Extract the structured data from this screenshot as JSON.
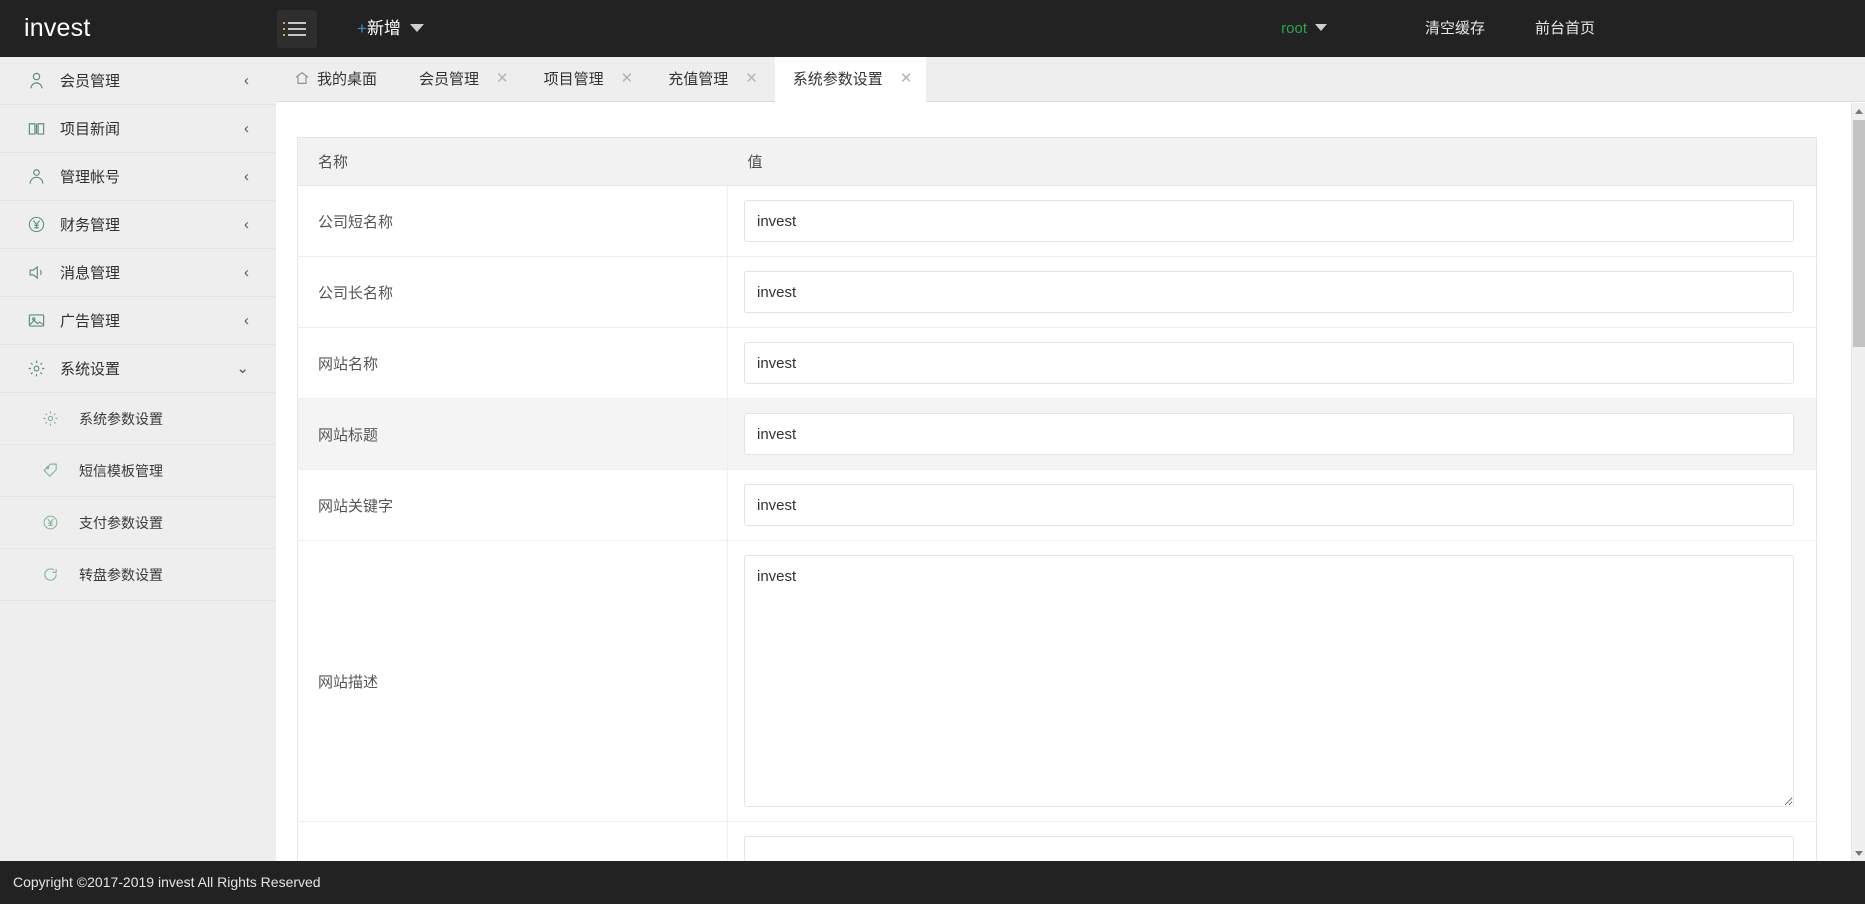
{
  "header": {
    "logo": "invest",
    "menu_toggle_icon": "hamburger-icon",
    "add_new_plus": "+",
    "add_new_label": "新增",
    "user": "root",
    "clear_cache": "清空缓存",
    "front_page": "前台首页",
    "bg_color": "#222222",
    "user_color": "#2ea44f"
  },
  "sidebar": {
    "items": [
      {
        "label": "会员管理",
        "icon": "user-icon",
        "arrow": "‹",
        "expanded": false
      },
      {
        "label": "项目新闻",
        "icon": "book-icon",
        "arrow": "‹",
        "expanded": false
      },
      {
        "label": "管理帐号",
        "icon": "user-circle-icon",
        "arrow": "‹",
        "expanded": false
      },
      {
        "label": "财务管理",
        "icon": "yen-circle-icon",
        "arrow": "‹",
        "expanded": false
      },
      {
        "label": "消息管理",
        "icon": "speaker-icon",
        "arrow": "‹",
        "expanded": false
      },
      {
        "label": "广告管理",
        "icon": "image-icon",
        "arrow": "‹",
        "expanded": false
      },
      {
        "label": "系统设置",
        "icon": "gear-icon",
        "arrow": "⌄",
        "expanded": true
      }
    ],
    "subitems": [
      {
        "label": "系统参数设置",
        "icon": "gear-icon"
      },
      {
        "label": "短信模板管理",
        "icon": "tag-icon"
      },
      {
        "label": "支付参数设置",
        "icon": "yen-circle-icon"
      },
      {
        "label": "转盘参数设置",
        "icon": "refresh-circle-icon"
      }
    ]
  },
  "tabs": [
    {
      "label": "我的桌面",
      "icon": "home-icon",
      "closable": false,
      "active": false
    },
    {
      "label": "会员管理",
      "icon": "",
      "closable": true,
      "active": false
    },
    {
      "label": "项目管理",
      "icon": "",
      "closable": true,
      "active": false
    },
    {
      "label": "充值管理",
      "icon": "",
      "closable": true,
      "active": false
    },
    {
      "label": "系统参数设置",
      "icon": "",
      "closable": true,
      "active": true
    }
  ],
  "tab_close_glyph": "✕",
  "table": {
    "columns": [
      "名称",
      "值"
    ],
    "rows": [
      {
        "name": "公司短名称",
        "value": "invest",
        "type": "input",
        "alt": false
      },
      {
        "name": "公司长名称",
        "value": "invest",
        "type": "input",
        "alt": false
      },
      {
        "name": "网站名称",
        "value": "invest",
        "type": "input",
        "alt": false
      },
      {
        "name": "网站标题",
        "value": "invest",
        "type": "input",
        "alt": true
      },
      {
        "name": "网站关键字",
        "value": "invest",
        "type": "input",
        "alt": false
      },
      {
        "name": "网站描述",
        "value": "invest",
        "type": "textarea",
        "alt": false
      },
      {
        "name": "",
        "value": "",
        "type": "input",
        "alt": false
      }
    ]
  },
  "scrollbar": {
    "up_icon": "chevron-up-icon",
    "down_icon": "chevron-down-icon",
    "thumb_position_percent": 2
  },
  "footer": {
    "text": "Copyright ©2017-2019 invest All Rights Reserved"
  }
}
